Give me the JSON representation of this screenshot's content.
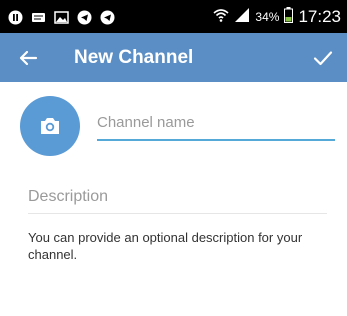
{
  "status_bar": {
    "battery_percent": "34%",
    "time": "17:23",
    "icons": [
      "pause-icon",
      "message-icon",
      "image-icon",
      "telegram-icon",
      "telegram-icon",
      "wifi-icon",
      "signal-icon",
      "battery-icon"
    ]
  },
  "app_bar": {
    "title": "New Channel",
    "back_icon": "arrow-left-icon",
    "done_icon": "checkmark-icon"
  },
  "form": {
    "channel_name_placeholder": "Channel name",
    "channel_name_value": "",
    "description_placeholder": "Description",
    "description_value": "",
    "help_text": "You can provide an optional description for your channel."
  },
  "colors": {
    "app_bar": "#5b8ec4",
    "avatar": "#5b9bd5",
    "accent_underline": "#54a9d8"
  }
}
